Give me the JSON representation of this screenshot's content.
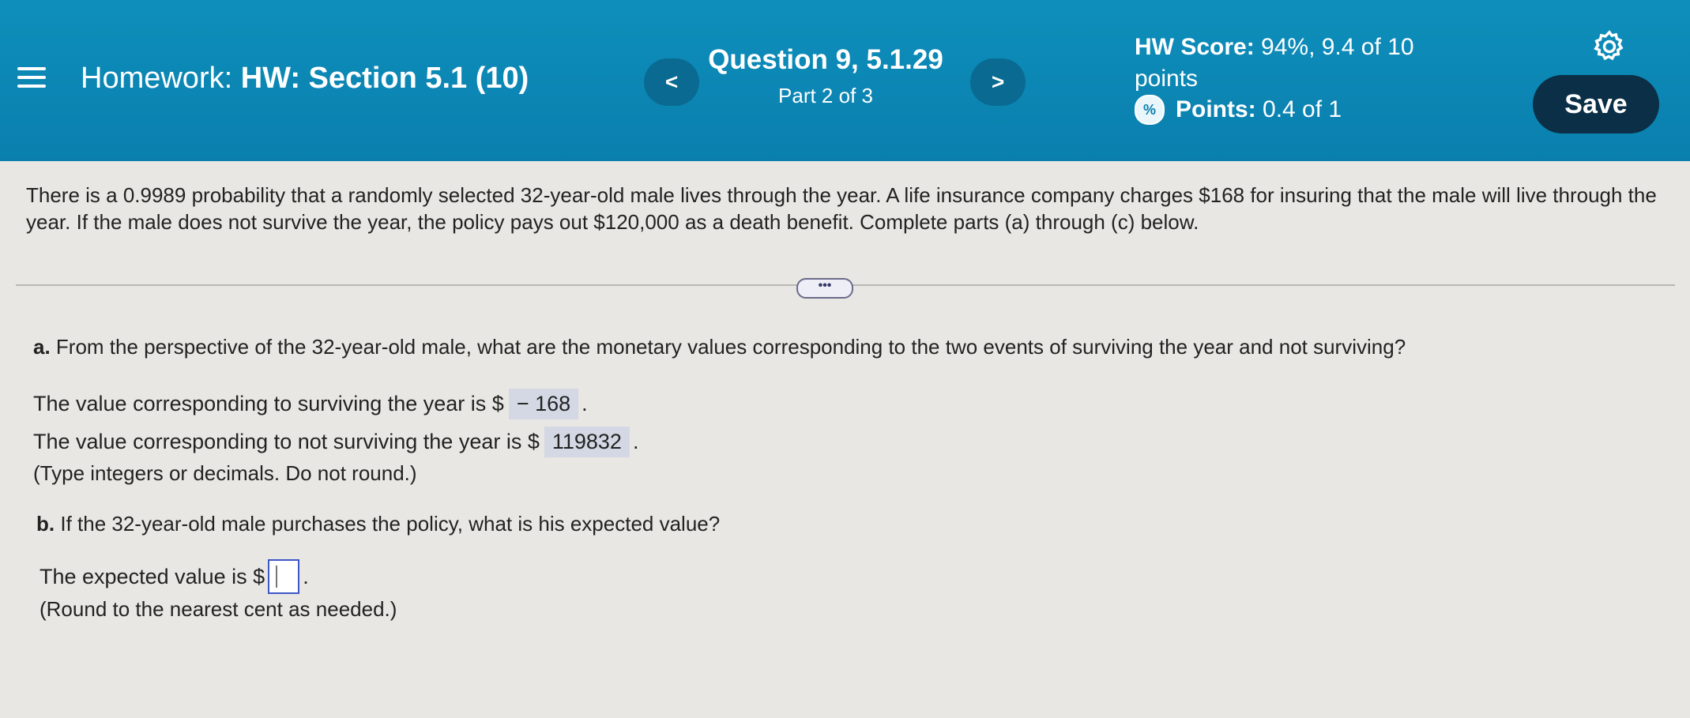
{
  "header": {
    "homework_label": "Homework:",
    "homework_name": "HW: Section 5.1 (10)",
    "question_title": "Question 9, 5.1.29",
    "question_part": "Part 2 of 3",
    "prev_label": "<",
    "next_label": ">",
    "score_label": "HW Score:",
    "score_value": "94%, 9.4 of 10",
    "score_unit": "points",
    "points_label": "Points:",
    "points_value": "0.4 of 1",
    "save_label": "Save"
  },
  "problem": {
    "text": "There is a 0.9989 probability that a randomly selected 32-year-old male lives through the year. A life insurance company charges $168 for insuring that the male will live through the year. If the male does not survive the year, the policy pays out $120,000 as a death benefit. Complete parts (a) through (c) below.",
    "more_label": "•••"
  },
  "part_a": {
    "label": "a.",
    "question": "From the perspective of the 32-year-old male, what are the monetary values corresponding to the two events of surviving the year and not surviving?",
    "survive_prefix": "The value corresponding to surviving the year is $",
    "survive_value": "− 168",
    "not_survive_prefix": "The value corresponding to not surviving the year is $",
    "not_survive_value": "119832",
    "period": ".",
    "hint": "(Type integers or decimals. Do not round.)"
  },
  "part_b": {
    "label": "b.",
    "question": "If the 32-year-old male purchases the policy, what is his expected value?",
    "expected_prefix": "The expected value is $",
    "expected_value": "",
    "period": ".",
    "hint": "(Round to the nearest cent as needed.)"
  }
}
